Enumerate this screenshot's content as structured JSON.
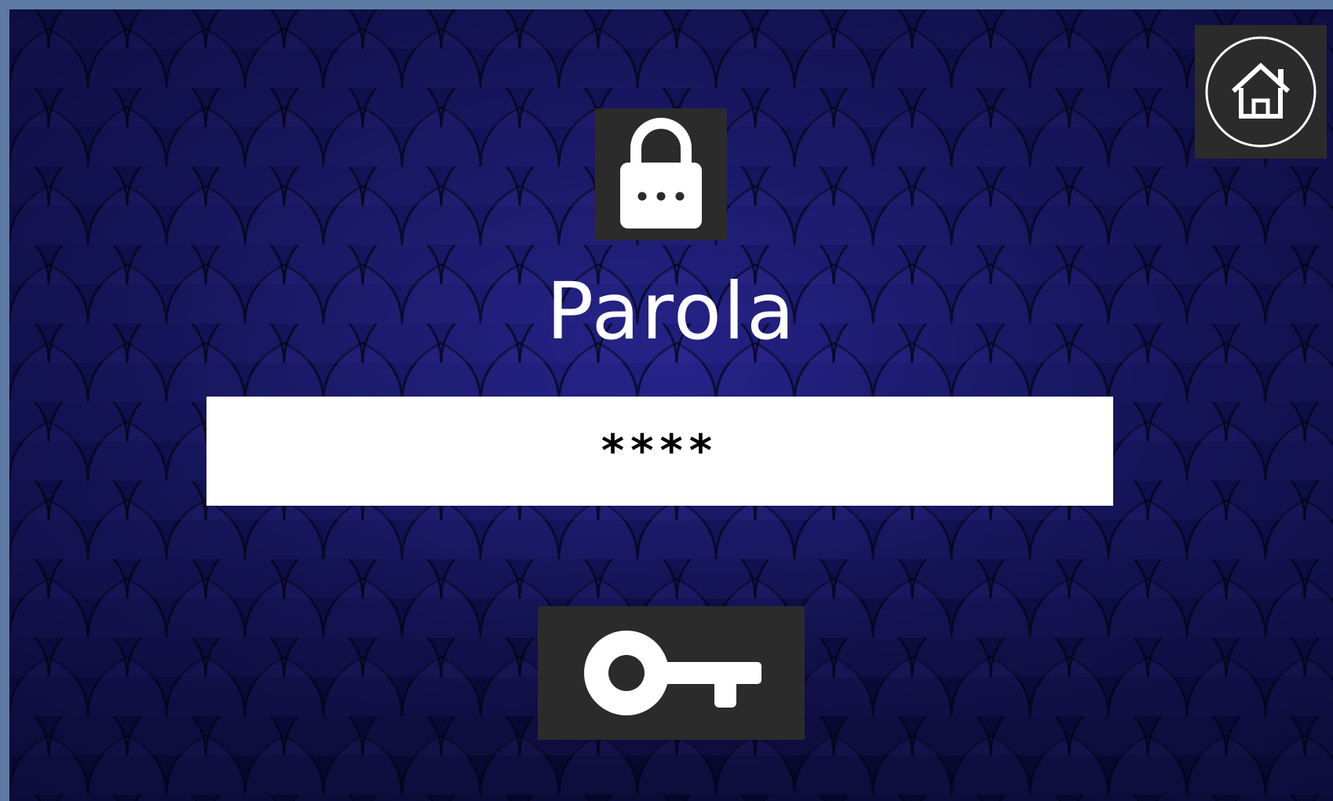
{
  "screen": {
    "title": "Parola",
    "password": {
      "value": "****"
    }
  },
  "icons": {
    "lock": "lock-icon",
    "home": "home-icon",
    "key": "key-icon"
  },
  "colors": {
    "background": "#15166a",
    "frame": "#5c7aa3",
    "tile": "#2b2b2b",
    "icon": "#ffffff"
  }
}
